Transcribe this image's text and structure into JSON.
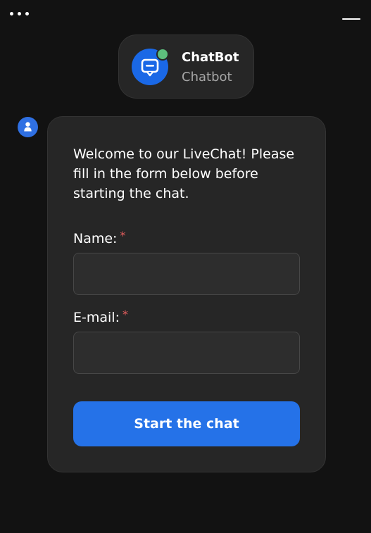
{
  "header": {
    "menu_icon": "more-horizontal-icon",
    "minimize_icon": "minimize-icon"
  },
  "agent": {
    "name": "ChatBot",
    "role": "Chatbot",
    "avatar_icon": "chat-bubble-icon",
    "status": "online",
    "avatar_color": "#1a68e6",
    "status_color": "#5dbe7d"
  },
  "message": {
    "author_icon": "user-icon",
    "text": "Welcome to our LiveChat! Please fill in the form below before starting the chat."
  },
  "form": {
    "name_label": "Name:",
    "name_required_mark": "*",
    "name_value": "",
    "email_label": "E-mail:",
    "email_required_mark": "*",
    "email_value": "",
    "submit_label": "Start the chat"
  },
  "colors": {
    "background": "#121212",
    "card": "#262626",
    "accent": "#2572e8",
    "required": "#e35d5d"
  }
}
